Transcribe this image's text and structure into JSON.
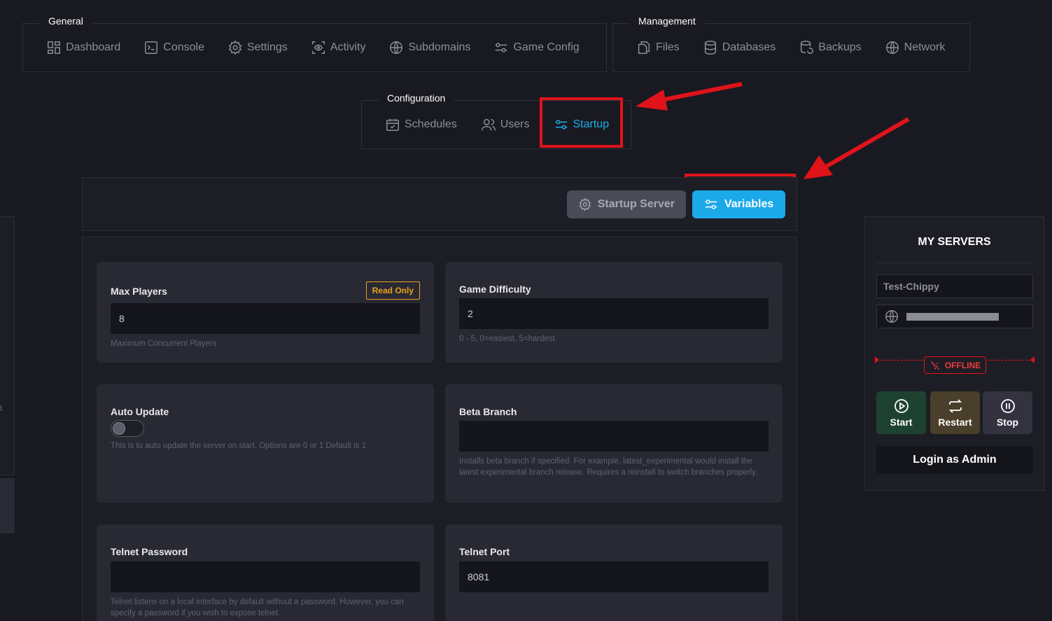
{
  "nav": {
    "general": {
      "title": "General",
      "items": [
        {
          "label": "Dashboard",
          "icon": "dashboard-icon"
        },
        {
          "label": "Console",
          "icon": "terminal-icon"
        },
        {
          "label": "Settings",
          "icon": "gear-icon"
        },
        {
          "label": "Activity",
          "icon": "eye-scan-icon"
        },
        {
          "label": "Subdomains",
          "icon": "globe-icon"
        },
        {
          "label": "Game Config",
          "icon": "sliders-icon"
        }
      ]
    },
    "management": {
      "title": "Management",
      "items": [
        {
          "label": "Files",
          "icon": "files-icon"
        },
        {
          "label": "Databases",
          "icon": "database-icon"
        },
        {
          "label": "Backups",
          "icon": "backup-icon"
        },
        {
          "label": "Network",
          "icon": "globe-icon"
        }
      ]
    },
    "configuration": {
      "title": "Configuration",
      "items": [
        {
          "label": "Schedules",
          "icon": "calendar-check-icon"
        },
        {
          "label": "Users",
          "icon": "users-icon"
        },
        {
          "label": "Startup",
          "icon": "sliders-icon",
          "active": true
        }
      ]
    }
  },
  "toolbar": {
    "startup_server_label": "Startup Server",
    "variables_label": "Variables"
  },
  "variables": [
    {
      "label": "Max Players",
      "value": "8",
      "description": "Maximum Concurrent Players",
      "badge": "Read Only"
    },
    {
      "label": "Game Difficulty",
      "value": "2",
      "description": "0 - 5, 0=easiest, 5=hardest"
    },
    {
      "label": "Auto Update",
      "type": "toggle",
      "toggle_on": false,
      "description": "This is to auto update the server on start. Options are 0 or 1 Default is 1"
    },
    {
      "label": "Beta Branch",
      "value": "",
      "description": "Installs beta branch if specified. For example, latest_experimental would install the latest experimental branch release. Requires a reinstall to switch branches properly."
    },
    {
      "label": "Telnet Password",
      "value": "",
      "description": "Telnet listens on a local interface by default without a password. However, you can specify a password if you wish to expose telnet."
    },
    {
      "label": "Telnet Port",
      "value": "8081",
      "description": ""
    }
  ],
  "my_servers": {
    "title": "MY SERVERS",
    "server_name": "Test-Chippy",
    "status": "OFFLINE",
    "start_label": "Start",
    "restart_label": "Restart",
    "stop_label": "Stop",
    "login_admin_label": "Login as Admin"
  },
  "left_stub_text": "t",
  "colors": {
    "accent": "#1ba9ea",
    "highlight_red": "#e0131a",
    "badge_amber": "#e8a51b",
    "background": "#191921"
  }
}
